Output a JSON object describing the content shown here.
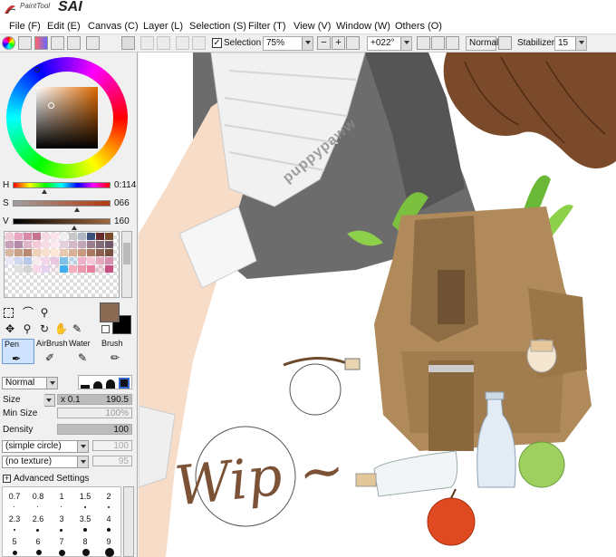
{
  "app": {
    "logo_small": "PaintTool",
    "logo_big": "SAI"
  },
  "menu": [
    "File (F)",
    "Edit (E)",
    "Canvas (C)",
    "Layer (L)",
    "Selection (S)",
    "Filter (T)",
    "View (V)",
    "Window (W)",
    "Others (O)"
  ],
  "toolbar": {
    "selection_label": "Selection",
    "selection_checked": true,
    "zoom": "75%",
    "rotation": "+022°",
    "blend_mode": "Normal",
    "stabilizer_label": "Stabilizer",
    "stabilizer_value": "15"
  },
  "color": {
    "h_label": "H",
    "h_value": "0:114",
    "s_label": "S",
    "s_value": "066",
    "v_label": "V",
    "v_value": "160",
    "h_fraction": 0.32,
    "s_fraction": 0.66,
    "v_fraction": 0.63,
    "primary": "#8a6a52",
    "secondary": "#000000"
  },
  "tools": {
    "names": [
      "Pen",
      "AirBrush",
      "Water",
      "Brush"
    ]
  },
  "brush": {
    "mode": "Normal",
    "size_label": "Size",
    "size_multiplier": "x 0.1",
    "size_value": "190.5",
    "min_size_label": "Min Size",
    "min_size_value": "100%",
    "density_label": "Density",
    "density_value": "100",
    "shape": "(simple circle)",
    "shape_value": "100",
    "texture": "(no texture)",
    "texture_value": "95",
    "advanced_label": "Advanced Settings",
    "size_presets_row1": [
      "0.7",
      "0.8",
      "1",
      "1.5",
      "2"
    ],
    "size_presets_row2": [
      "2.3",
      "2.6",
      "3",
      "3.5",
      "4"
    ],
    "size_presets_row3": [
      "5",
      "6",
      "7",
      "8",
      "9"
    ]
  },
  "canvas": {
    "watermark": "puppypaww",
    "wip_text": "Wip ~"
  }
}
